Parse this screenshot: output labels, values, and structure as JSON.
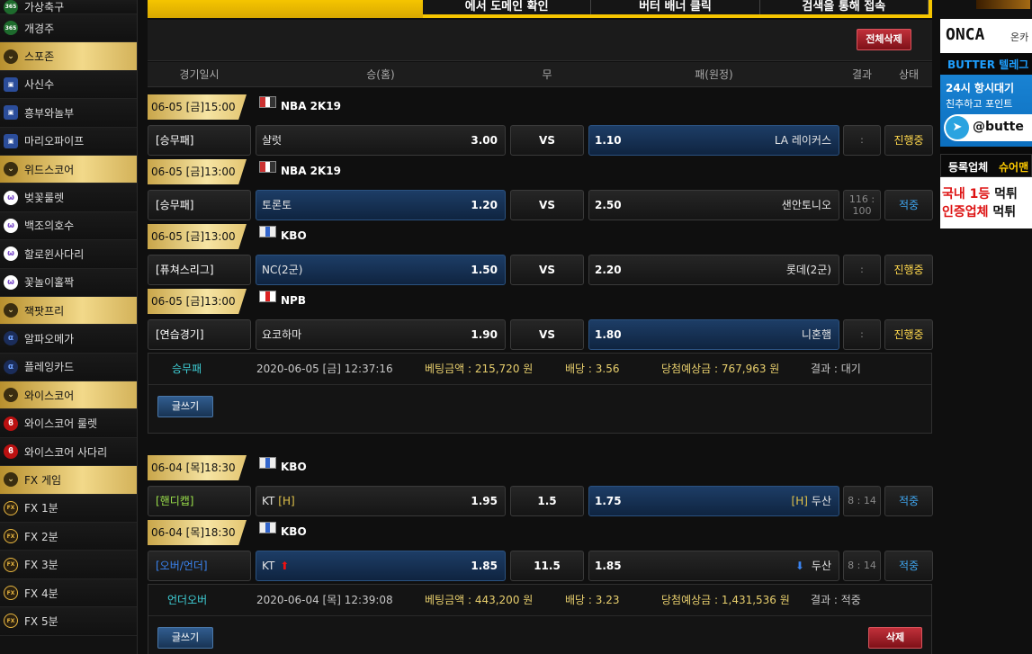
{
  "sidebar": {
    "items": [
      {
        "label": "가상축구",
        "icon": "bet365-icon",
        "cat": false
      },
      {
        "label": "개경주",
        "icon": "bet365-icon",
        "cat": false
      },
      {
        "label": "스포존",
        "icon": "chevron-down-icon",
        "cat": true
      },
      {
        "label": "사신수",
        "icon": "mario-icon",
        "cat": false
      },
      {
        "label": "흥부와놀부",
        "icon": "mario-icon",
        "cat": false
      },
      {
        "label": "마리오파이프",
        "icon": "mario-icon",
        "cat": false
      },
      {
        "label": "위드스코어",
        "icon": "chevron-down-icon",
        "cat": true
      },
      {
        "label": "벚꽃룰렛",
        "icon": "powerball-icon",
        "cat": false
      },
      {
        "label": "백조의호수",
        "icon": "powerball-icon",
        "cat": false
      },
      {
        "label": "할로윈사다리",
        "icon": "powerball-icon",
        "cat": false
      },
      {
        "label": "꽃놀이홀짝",
        "icon": "powerball-icon",
        "cat": false
      },
      {
        "label": "잭팟프리",
        "icon": "chevron-down-icon",
        "cat": true
      },
      {
        "label": "알파오메가",
        "icon": "alpha-icon",
        "cat": false
      },
      {
        "label": "플레잉카드",
        "icon": "alpha-icon",
        "cat": false
      },
      {
        "label": "와이스코어",
        "icon": "chevron-down-icon",
        "cat": true
      },
      {
        "label": "와이스코어 룰렛",
        "icon": "wisescore-icon",
        "cat": false
      },
      {
        "label": "와이스코어 사다리",
        "icon": "wisescore-icon",
        "cat": false
      },
      {
        "label": "FX 게임",
        "icon": "chevron-down-icon",
        "cat": true
      },
      {
        "label": "FX 1분",
        "icon": "fx-icon",
        "cat": false
      },
      {
        "label": "FX 2분",
        "icon": "fx-icon",
        "cat": false
      },
      {
        "label": "FX 3분",
        "icon": "fx-icon",
        "cat": false
      },
      {
        "label": "FX 4분",
        "icon": "fx-icon",
        "cat": false
      },
      {
        "label": "FX 5분",
        "icon": "fx-icon",
        "cat": false
      }
    ]
  },
  "banner": {
    "segments": [
      "에서 도메인 확인",
      "버터 배너 클릭",
      "검색을 통해 접속"
    ]
  },
  "toolbar": {
    "delete_all_label": "전체삭제"
  },
  "columns": {
    "time": "경기일시",
    "home": "승(홈)",
    "draw": "무",
    "away": "패(원정)",
    "result": "결과",
    "status": "상태"
  },
  "slips": [
    {
      "games": [
        {
          "date": "06-05 [금]15:00",
          "league": "NBA 2K19",
          "type": "[승무패]",
          "type_color": "",
          "home": "샬럿",
          "home_odd": "3.00",
          "home_hl": false,
          "draw": "VS",
          "away_odd": "1.10",
          "away": "LA 레이커스",
          "away_hl": true,
          "result": ":",
          "status": "진행중"
        },
        {
          "date": "06-05 [금]13:00",
          "league": "NBA 2K19",
          "type": "[승무패]",
          "type_color": "",
          "home": "토론토",
          "home_odd": "1.20",
          "home_hl": true,
          "draw": "VS",
          "away_odd": "2.50",
          "away": "샌안토니오",
          "away_hl": false,
          "result": "116 : 100",
          "status": "적중"
        },
        {
          "date": "06-05 [금]13:00",
          "league": "KBO",
          "type": "[퓨쳐스리그]",
          "type_color": "",
          "home": "NC(2군)",
          "home_odd": "1.50",
          "home_hl": true,
          "draw": "VS",
          "away_odd": "2.20",
          "away": "롯데(2군)",
          "away_hl": false,
          "result": ":",
          "status": "진행중"
        },
        {
          "date": "06-05 [금]13:00",
          "league": "NPB",
          "type": "[연습경기]",
          "type_color": "",
          "home": "요코하마",
          "home_odd": "1.90",
          "home_hl": false,
          "draw": "VS",
          "away_odd": "1.80",
          "away": "니혼햄",
          "away_hl": true,
          "result": ":",
          "status": "진행중"
        }
      ],
      "summary": {
        "bet_type": "승무패",
        "time": "2020-06-05 [금] 12:37:16",
        "amount": "베팅금액 : 215,720 원",
        "odds": "배당 : 3.56",
        "expected": "당첨예상금 : 767,963 원",
        "result": "결과 : 대기",
        "write_label": "글쓰기"
      }
    },
    {
      "games": [
        {
          "date": "06-04 [목]18:30",
          "league": "KBO",
          "type": "[핸디캡]",
          "type_color": "green",
          "home": "KT",
          "home_tag": "[H]",
          "home_odd": "1.95",
          "home_hl": false,
          "draw": "1.5",
          "away_odd": "1.75",
          "away_tag": "[H]",
          "away": "두산",
          "away_hl": true,
          "result": "8 : 14",
          "status": "적중"
        },
        {
          "date": "06-04 [목]18:30",
          "league": "KBO",
          "type": "[오버/언더]",
          "type_color": "blue",
          "home": "KT",
          "home_arrow": "▲",
          "home_odd": "1.85",
          "home_hl": true,
          "draw": "11.5",
          "away_odd": "1.85",
          "away_arrow": "▼",
          "away": "두산",
          "away_hl": false,
          "result": "8 : 14",
          "status": "적중"
        }
      ],
      "summary": {
        "bet_type": "언더오버",
        "time": "2020-06-04 [목] 12:39:08",
        "amount": "베팅금액 : 443,200 원",
        "odds": "배당 : 3.23",
        "expected": "당첨예상금 : 1,431,536 원",
        "result": "결과 : 적중",
        "write_label": "글쓰기",
        "delete_label": "삭제"
      }
    }
  ],
  "ads": {
    "onca": "ONCA",
    "onca_sub": "온카",
    "butter_title": "BUTTER 텔레그",
    "butter_line1": "24시 항시대기",
    "butter_line2": "친추하고 포인트",
    "butter_handle": "@butte",
    "reg_line": "등록업체",
    "reg_brand": "슈어맨",
    "red_line1": "국내 1등",
    "red_line1b": "먹튀",
    "red_line2": "인증업체",
    "red_line2b": "먹튀"
  }
}
